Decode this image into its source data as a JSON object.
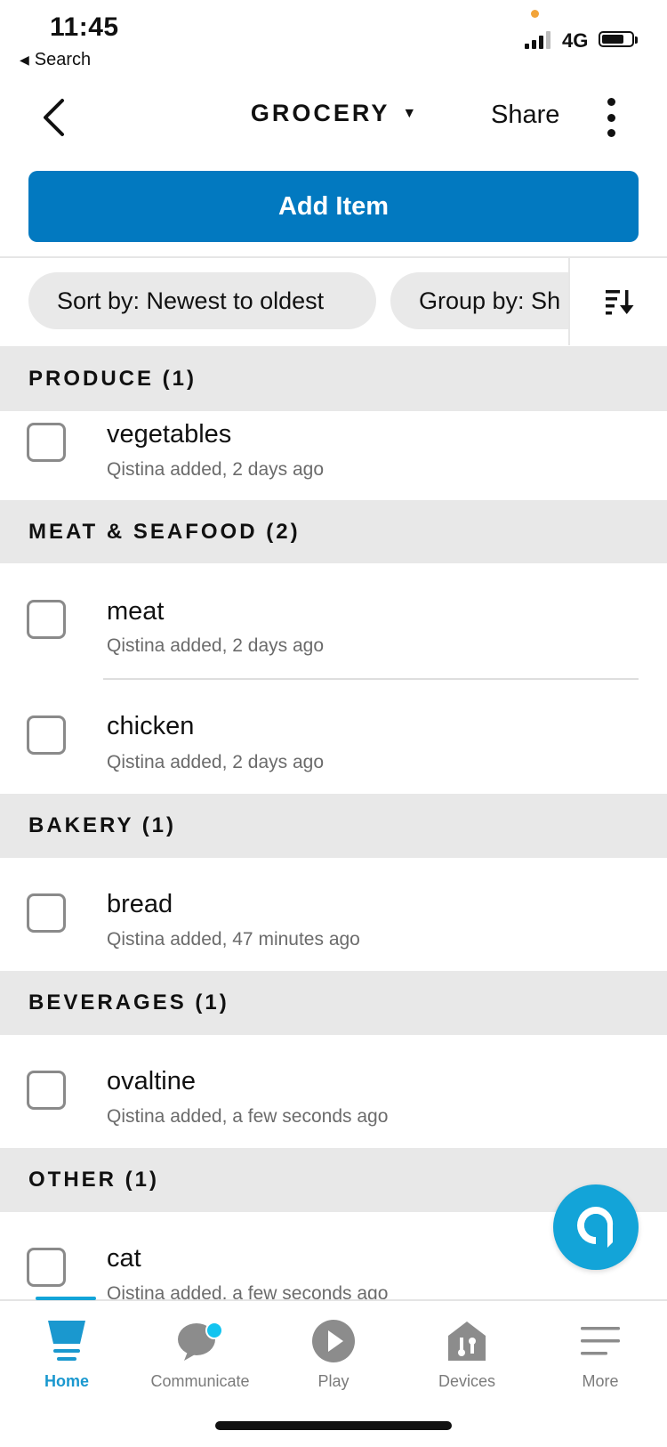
{
  "status": {
    "time": "11:45",
    "back_label": "Search",
    "network": "4G"
  },
  "header": {
    "title": "GROCERY",
    "caret": "▼",
    "share_label": "Share"
  },
  "add_button": {
    "label": "Add Item"
  },
  "filters": {
    "sort_label": "Sort by: Newest to oldest",
    "group_label": "Group by: Sh"
  },
  "sections": [
    {
      "title": "PRODUCE (1)",
      "items": [
        {
          "name": "vegetables",
          "meta": "Qistina added, 2 days ago"
        }
      ]
    },
    {
      "title": "MEAT & SEAFOOD (2)",
      "items": [
        {
          "name": "meat",
          "meta": "Qistina added, 2 days ago"
        },
        {
          "name": "chicken",
          "meta": "Qistina added, 2 days ago"
        }
      ]
    },
    {
      "title": "BAKERY (1)",
      "items": [
        {
          "name": "bread",
          "meta": "Qistina added, 47 minutes ago"
        }
      ]
    },
    {
      "title": "BEVERAGES (1)",
      "items": [
        {
          "name": "ovaltine",
          "meta": "Qistina added, a few seconds ago"
        }
      ]
    },
    {
      "title": "OTHER (1)",
      "items": [
        {
          "name": "cat",
          "meta": "Qistina added, a few seconds ago"
        }
      ]
    }
  ],
  "nav": [
    {
      "label": "Home",
      "icon": "home-icon",
      "active": true
    },
    {
      "label": "Communicate",
      "icon": "chat-icon",
      "active": false
    },
    {
      "label": "Play",
      "icon": "play-icon",
      "active": false
    },
    {
      "label": "Devices",
      "icon": "devices-icon",
      "active": false
    },
    {
      "label": "More",
      "icon": "menu-icon",
      "active": false
    }
  ],
  "colors": {
    "accent": "#0279c0",
    "alexa": "#13a4d8",
    "section_bg": "#e8e8e8"
  }
}
